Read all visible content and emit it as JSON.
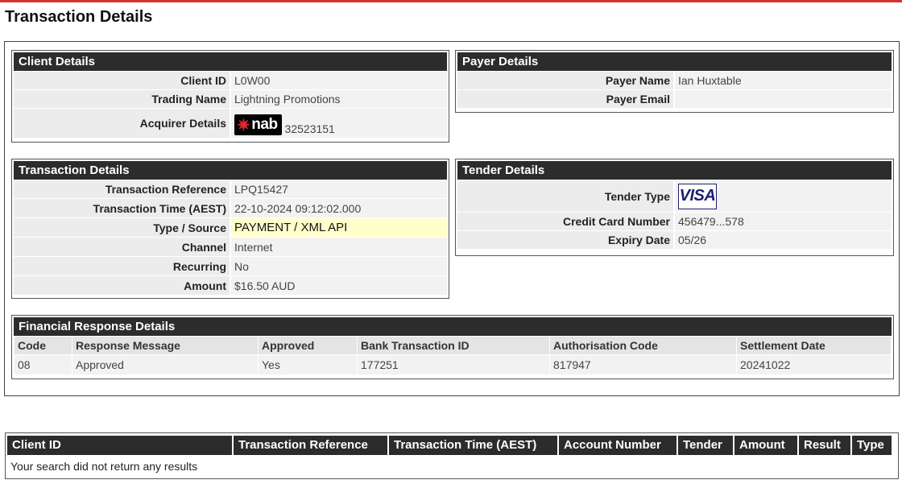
{
  "page": {
    "title": "Transaction Details"
  },
  "client_details": {
    "title": "Client Details",
    "rows": [
      {
        "label": "Client ID",
        "value": "L0W00"
      },
      {
        "label": "Trading Name",
        "value": "Lightning Promotions"
      },
      {
        "label": "Acquirer Details",
        "logo_text": "nab",
        "value": "32523151"
      }
    ]
  },
  "payer_details": {
    "title": "Payer Details",
    "rows": [
      {
        "label": "Payer Name",
        "value": "Ian Huxtable"
      },
      {
        "label": "Payer Email",
        "value": ""
      }
    ]
  },
  "transaction_details": {
    "title": "Transaction Details",
    "rows": [
      {
        "label": "Transaction Reference",
        "value": "LPQ15427"
      },
      {
        "label": "Transaction Time (AEST)",
        "value": "22-10-2024 09:12:02.000"
      },
      {
        "label": "Type / Source",
        "value": "PAYMENT / XML API"
      },
      {
        "label": "Channel",
        "value": "Internet"
      },
      {
        "label": "Recurring",
        "value": "No"
      },
      {
        "label": "Amount",
        "value": "$16.50 AUD"
      }
    ]
  },
  "tender_details": {
    "title": "Tender Details",
    "rows": [
      {
        "label": "Tender Type",
        "logo_text": "VISA"
      },
      {
        "label": "Credit Card Number",
        "value": "456479...578"
      },
      {
        "label": "Expiry Date",
        "value": "05/26"
      }
    ]
  },
  "financial_response": {
    "title": "Financial Response Details",
    "columns": [
      "Code",
      "Response Message",
      "Approved",
      "Bank Transaction ID",
      "Authorisation Code",
      "Settlement Date"
    ],
    "row": [
      "08",
      "Approved",
      "Yes",
      "177251",
      "817947",
      "20241022"
    ]
  },
  "search_results": {
    "columns": [
      "Client ID",
      "Transaction Reference",
      "Transaction Time (AEST)",
      "Account Number",
      "Tender",
      "Amount",
      "Result",
      "Type"
    ],
    "empty_message": "Your search did not return any results"
  },
  "colors": {
    "header_bg": "#2c2c2c",
    "label_bg": "#ececec",
    "value_bg": "#f2f2f2",
    "highlight_bg": "#ffffcc",
    "accent_red": "#d9322c",
    "visa_blue": "#1a1f71"
  },
  "icons": {
    "acquirer_logo": "nab-logo",
    "tender_logo": "visa-logo"
  }
}
